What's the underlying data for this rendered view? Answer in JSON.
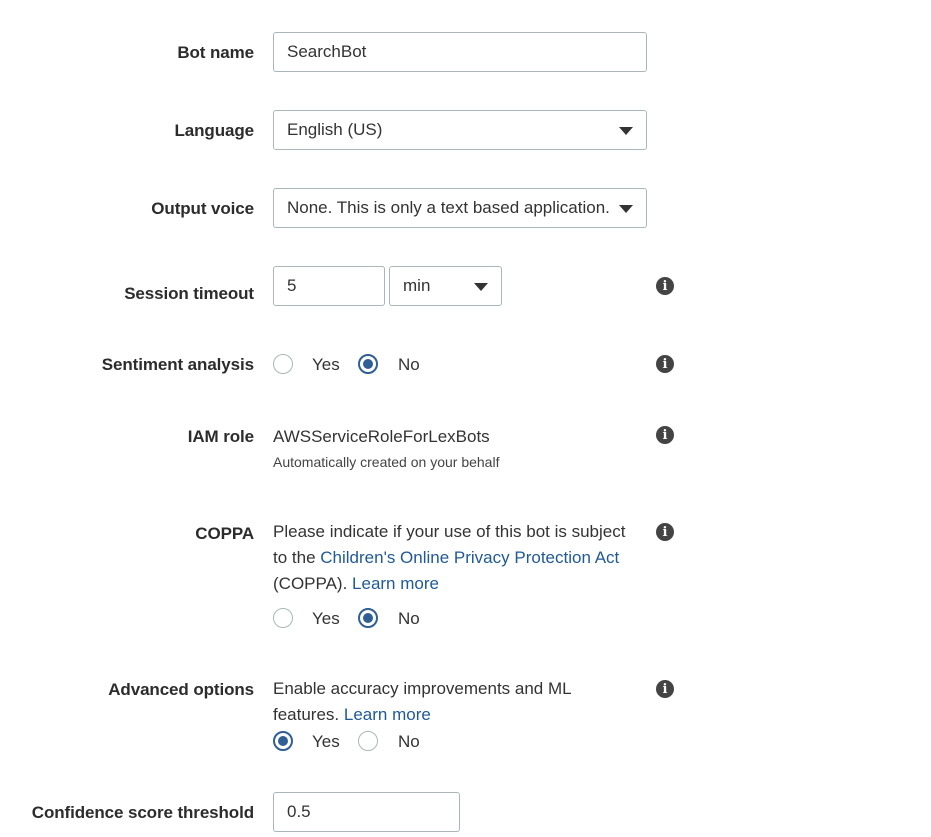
{
  "bot_name": {
    "label": "Bot name",
    "value": "SearchBot"
  },
  "language": {
    "label": "Language",
    "value": "English (US)"
  },
  "output_voice": {
    "label": "Output voice",
    "value": "None. This is only a text based application."
  },
  "session_timeout": {
    "label": "Session timeout",
    "value": "5",
    "unit": "min"
  },
  "sentiment": {
    "label": "Sentiment analysis",
    "yes": "Yes",
    "no": "No",
    "selected": "No"
  },
  "iam_role": {
    "label": "IAM role",
    "value": "AWSServiceRoleForLexBots",
    "note": "Automatically created on your behalf"
  },
  "coppa": {
    "label": "COPPA",
    "text_1": "Please indicate if your use of this bot is subject",
    "text_2": "to the ",
    "link": "Children's Online Privacy Protection Act",
    "text_3": "(COPPA). ",
    "learn_more": "Learn more",
    "yes": "Yes",
    "no": "No",
    "selected": "No"
  },
  "advanced": {
    "label": "Advanced options",
    "text_1": "Enable accuracy improvements and ML",
    "text_2": "features. ",
    "learn_more": "Learn more",
    "yes": "Yes",
    "no": "No",
    "selected": "Yes"
  },
  "confidence": {
    "label": "Confidence score threshold",
    "value": "0.5"
  },
  "icons": {
    "info": "info-icon",
    "dropdown": "caret-down-icon"
  },
  "colors": {
    "accent": "#2f5f95",
    "link": "#1f5a96",
    "border": "#aab7b8"
  }
}
